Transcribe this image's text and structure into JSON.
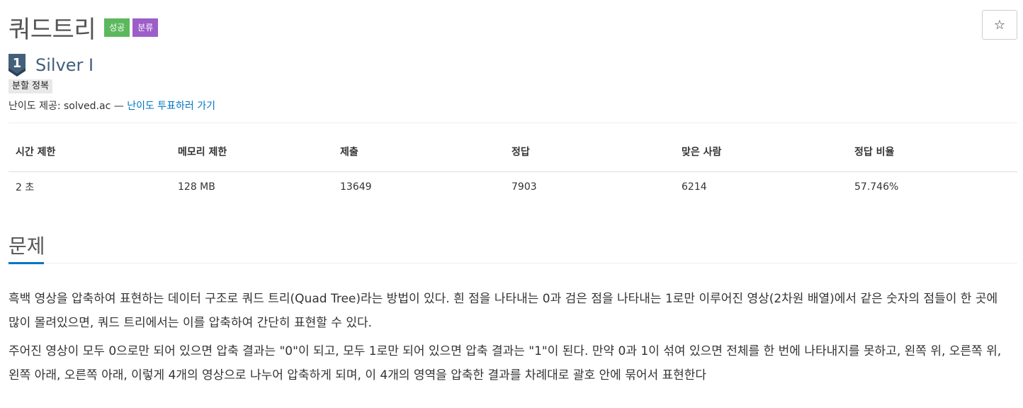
{
  "header": {
    "title": "쿼드트리",
    "labels": [
      "성공",
      "분류"
    ],
    "star_icon": "☆"
  },
  "tier": {
    "number": "1",
    "name": "Silver I",
    "color": "#435f7a"
  },
  "tag": "분할 정복",
  "difficulty": {
    "prefix": "난이도 제공: solved.ac — ",
    "link": "난이도 투표하러 가기"
  },
  "stats": {
    "headers": [
      "시간 제한",
      "메모리 제한",
      "제출",
      "정답",
      "맞은 사람",
      "정답 비율"
    ],
    "values": [
      "2 초",
      "128 MB",
      "13649",
      "7903",
      "6214",
      "57.746%"
    ]
  },
  "problem": {
    "heading": "문제",
    "paragraphs": [
      "흑백 영상을 압축하여 표현하는 데이터 구조로 쿼드 트리(Quad Tree)라는 방법이 있다. 흰 점을 나타내는 0과 검은 점을 나타내는 1로만 이루어진 영상(2차원 배열)에서 같은 숫자의 점들이 한 곳에 많이 몰려있으면, 쿼드 트리에서는 이를 압축하여 간단히 표현할 수 있다.",
      "주어진 영상이 모두 0으로만 되어 있으면 압축 결과는 \"0\"이 되고, 모두 1로만 되어 있으면 압축 결과는 \"1\"이 된다. 만약 0과 1이 섞여 있으면 전체를 한 번에 나타내지를 못하고, 왼쪽 위, 오른쪽 위, 왼쪽 아래, 오른쪽 아래, 이렇게 4개의 영상으로 나누어 압축하게 되며, 이 4개의 영역을 압축한 결과를 차례대로 괄호 안에 묶어서 표현한다"
    ]
  },
  "colors": {
    "success_label": "#5cb85c",
    "classified_label": "#9c5ec9",
    "link": "#0076c0"
  }
}
